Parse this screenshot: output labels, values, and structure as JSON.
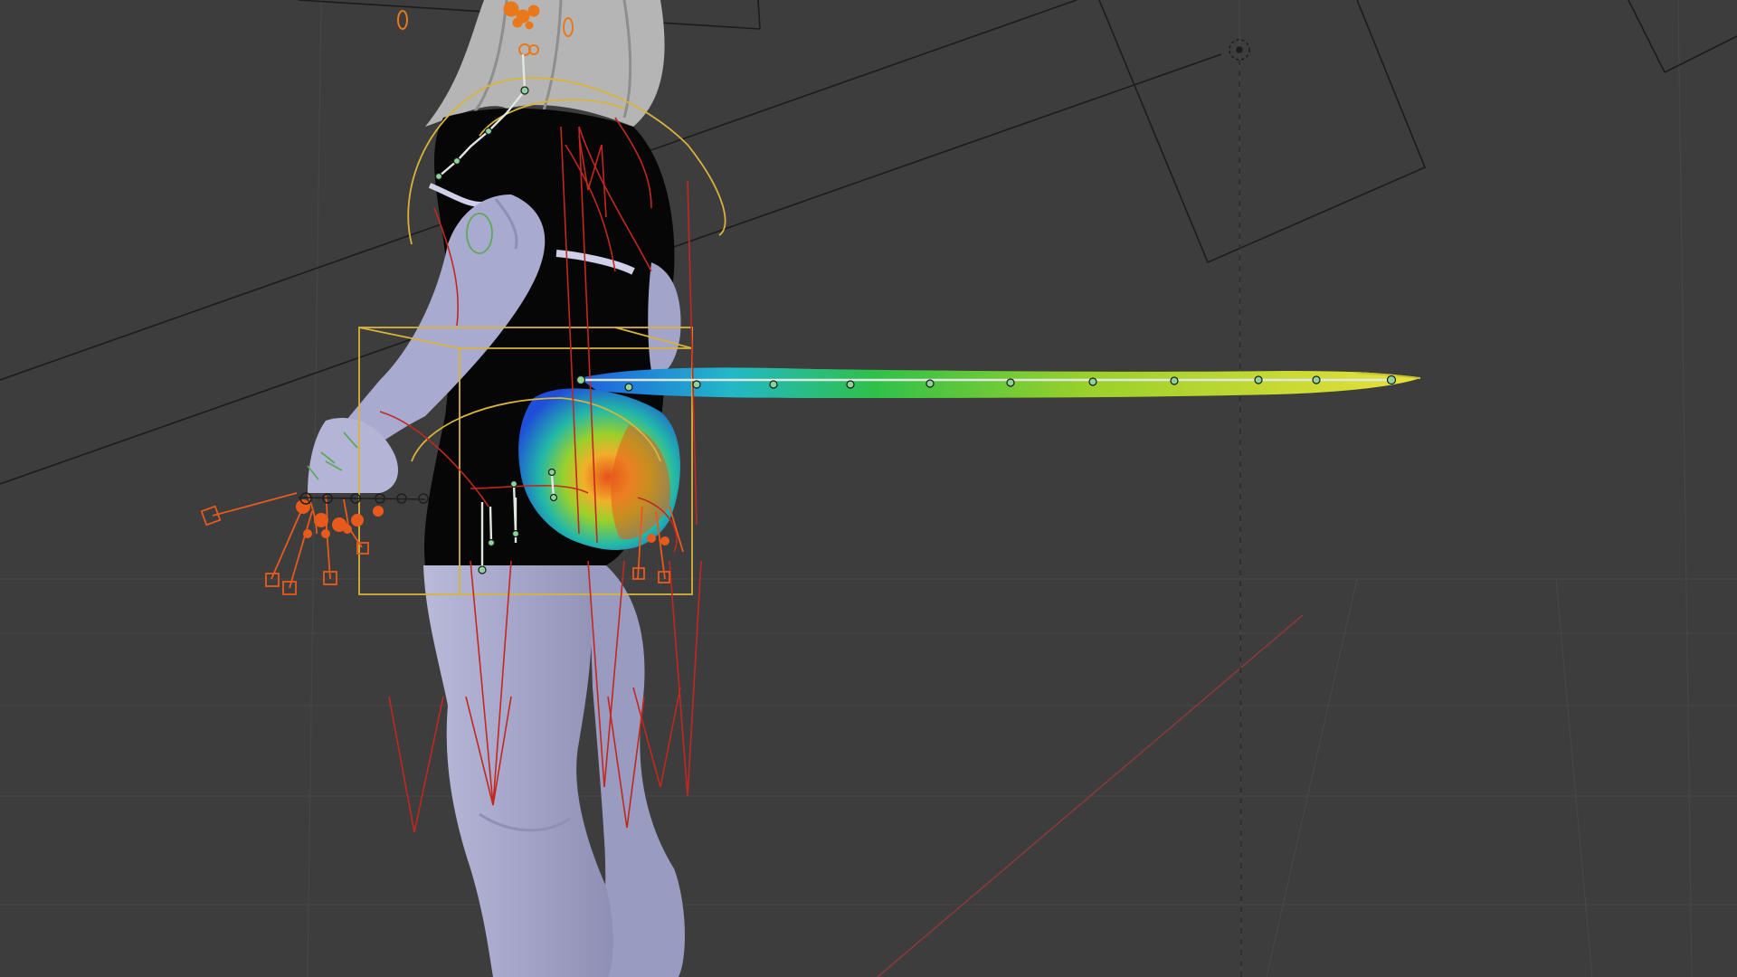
{
  "viewport": {
    "editor": "3D Viewport",
    "shading": "solid",
    "weight_paint_overlay": true
  },
  "colors": {
    "background": "#3d3d3d",
    "grid_line": "#474747",
    "x_axis": "#8a3a3a",
    "mesh_body": "#a7a8cc",
    "mesh_cloth": "#050505",
    "hair": "#b5b5b5",
    "bone_control": "#d8b43a",
    "bone_ik": "#c2281f",
    "bone_selected": "#e85a1c",
    "bone_deform": "#8fd29a",
    "weight_low": "#1f4fd8",
    "weight_mid": "#2fc04a",
    "weight_high": "#e8e03a",
    "weight_max": "#e83a1a",
    "camera_frame": "#1a1a1a"
  },
  "objects": [
    {
      "name": "character-mesh",
      "icon": "mesh-icon"
    },
    {
      "name": "armature-rig",
      "icon": "armature-icon"
    },
    {
      "name": "tail-weight-paint",
      "icon": "weight-icon"
    },
    {
      "name": "camera-frustum",
      "icon": "camera-icon"
    },
    {
      "name": "light-empty",
      "icon": "light-icon"
    }
  ]
}
